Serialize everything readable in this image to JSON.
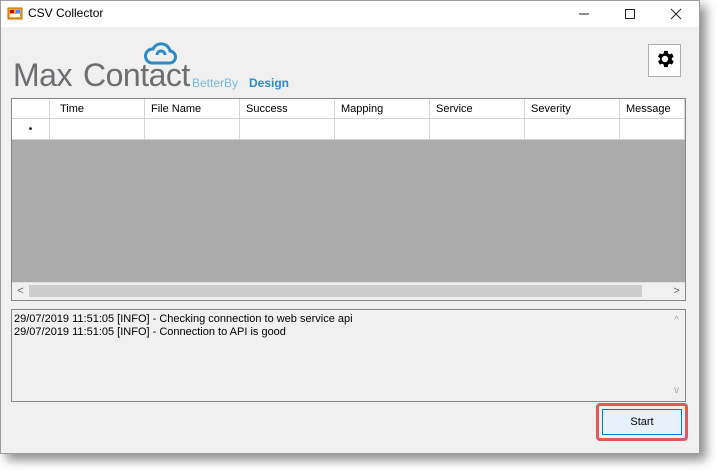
{
  "window": {
    "title": "CSV Collector",
    "controls": {
      "minimize": "—",
      "maximize": "☐",
      "close": "✕"
    }
  },
  "logo": {
    "max": "Max",
    "contact": "Contact",
    "tagline_better": "BetterBy",
    "tagline_design": "Design",
    "colors": {
      "text": "#6d6e71",
      "accent": "#2b8bc4"
    }
  },
  "grid": {
    "columns": [
      "Time",
      "File Name",
      "Success",
      "Mapping",
      "Service",
      "Severity",
      "Message"
    ],
    "new_row_marker": "•",
    "scroll_left": "<",
    "scroll_right": ">"
  },
  "log": {
    "lines": [
      "29/07/2019 11:51:05 [INFO] - Checking connection to web service api",
      "29/07/2019 11:51:05 [INFO] - Connection to API is good"
    ],
    "scroll_up": "^",
    "scroll_down": "v"
  },
  "actions": {
    "start_label": "Start",
    "highlight_color": "#e0585a"
  }
}
